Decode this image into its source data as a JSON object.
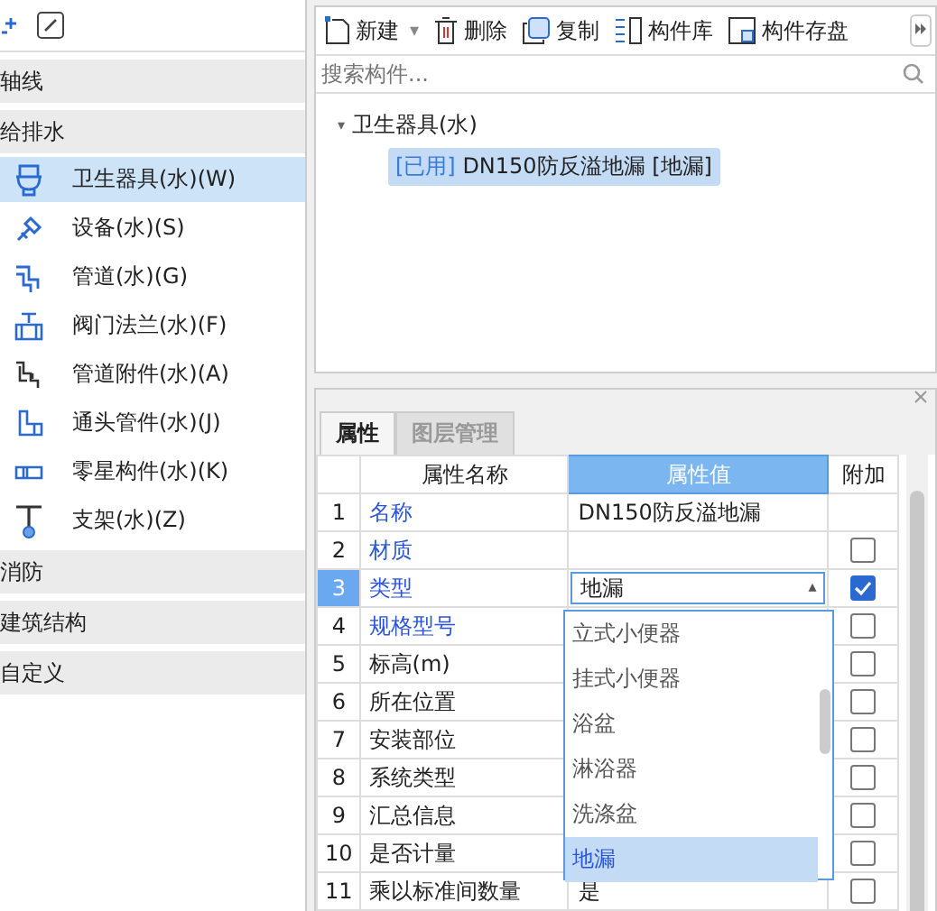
{
  "categories": [
    {
      "label": "轴线"
    },
    {
      "label": "给排水",
      "items": [
        {
          "label": "卫生器具(水)(W)",
          "selected": true
        },
        {
          "label": "设备(水)(S)",
          "selected": false
        },
        {
          "label": "管道(水)(G)",
          "selected": false
        },
        {
          "label": "阀门法兰(水)(F)",
          "selected": false
        },
        {
          "label": "管道附件(水)(A)",
          "selected": false
        },
        {
          "label": "通头管件(水)(J)",
          "selected": false
        },
        {
          "label": "零星构件(水)(K)",
          "selected": false
        },
        {
          "label": "支架(水)(Z)",
          "selected": false
        }
      ]
    },
    {
      "label": "消防"
    },
    {
      "label": "建筑结构"
    },
    {
      "label": "自定义"
    }
  ],
  "toolbar": [
    {
      "label": "新建",
      "menu_caret": "▾"
    },
    {
      "label": "删除"
    },
    {
      "label": "复制"
    },
    {
      "label": "构件库"
    },
    {
      "label": "构件存盘"
    }
  ],
  "search": {
    "placeholder": "搜索构件..."
  },
  "tree": [
    {
      "label": "卫生器具(水)",
      "arrow": "▾",
      "children": [
        {
          "tag": "[已用]",
          "label": "DN150防反溢地漏 [地漏]",
          "selected": true
        }
      ]
    }
  ],
  "tabs": [
    {
      "label": "属性",
      "selected": true
    },
    {
      "label": "图层管理",
      "selected": false
    }
  ],
  "table": {
    "columns": [
      "属性名称",
      "属性值",
      "附加"
    ],
    "rows": [
      {
        "index": "1",
        "name": "名称",
        "value": "DN150防反溢地漏",
        "public": true,
        "kind": "plain",
        "selected": false
      },
      {
        "index": "2",
        "name": "材质",
        "value": "",
        "public": true,
        "kind": "check",
        "checked": false,
        "selected": false
      },
      {
        "index": "3",
        "name": "类型",
        "value": "地漏",
        "public": true,
        "kind": "check",
        "checked": true,
        "selected": true
      },
      {
        "index": "4",
        "name": "规格型号",
        "value": "",
        "public": true,
        "kind": "check",
        "checked": false,
        "selected": false
      },
      {
        "index": "5",
        "name": "标高(m)",
        "value": "",
        "public": false,
        "kind": "check",
        "checked": false,
        "selected": false
      },
      {
        "index": "6",
        "name": "所在位置",
        "value": "",
        "public": false,
        "kind": "check",
        "checked": false,
        "selected": false
      },
      {
        "index": "7",
        "name": "安装部位",
        "value": "",
        "public": false,
        "kind": "check",
        "checked": false,
        "selected": false
      },
      {
        "index": "8",
        "name": "系统类型",
        "value": "",
        "public": false,
        "kind": "check",
        "checked": false,
        "selected": false
      },
      {
        "index": "9",
        "name": "汇总信息",
        "value": "",
        "public": false,
        "kind": "check",
        "checked": false,
        "selected": false
      },
      {
        "index": "10",
        "name": "是否计量",
        "value": "",
        "public": false,
        "kind": "check",
        "checked": false,
        "selected": false
      },
      {
        "index": "11",
        "name": "乘以标准间数量",
        "value": "是",
        "public": false,
        "kind": "check",
        "checked": false,
        "selected": false
      }
    ]
  },
  "dropdown": {
    "caret": "▴",
    "options": [
      {
        "label": "立式小便器",
        "selected": false
      },
      {
        "label": "挂式小便器",
        "selected": false
      },
      {
        "label": "浴盆",
        "selected": false
      },
      {
        "label": "淋浴器",
        "selected": false
      },
      {
        "label": "洗涤盆",
        "selected": false
      },
      {
        "label": "地漏",
        "selected": true
      }
    ]
  }
}
